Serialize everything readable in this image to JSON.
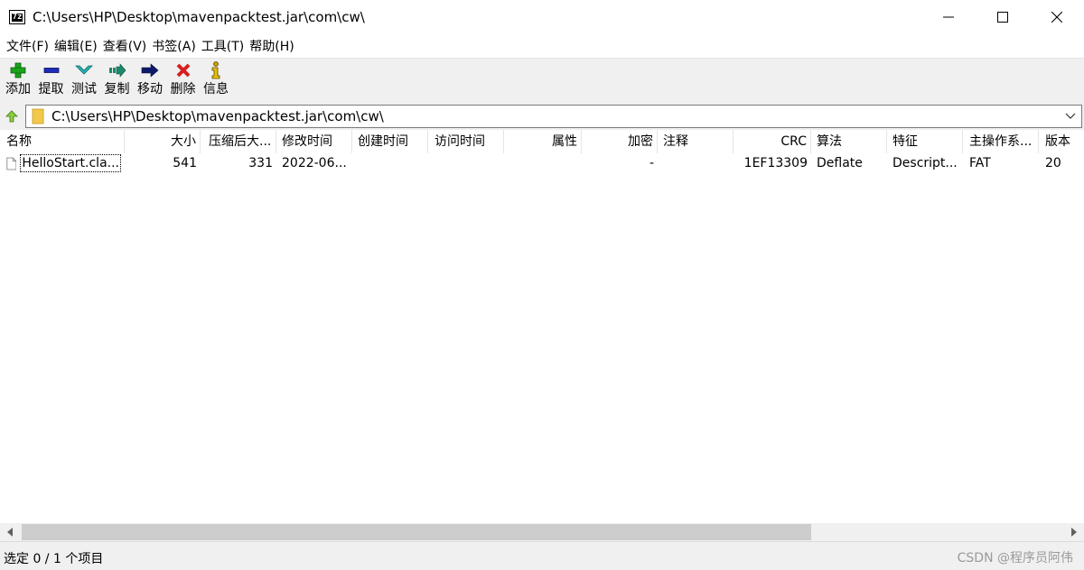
{
  "window": {
    "title": "C:\\Users\\HP\\Desktop\\mavenpacktest.jar\\com\\cw\\",
    "app_icon_text": "7z",
    "controls": [
      "minimize-icon",
      "maximize-icon",
      "close-icon"
    ]
  },
  "menu": {
    "items": [
      {
        "label": "文件(F)"
      },
      {
        "label": "编辑(E)"
      },
      {
        "label": "查看(V)"
      },
      {
        "label": "书签(A)"
      },
      {
        "label": "工具(T)"
      },
      {
        "label": "帮助(H)"
      }
    ]
  },
  "toolbar": {
    "buttons": [
      {
        "label": "添加",
        "icon": "plus-icon",
        "color": "#1aa31a"
      },
      {
        "label": "提取",
        "icon": "minus-icon",
        "color": "#1c2bb8"
      },
      {
        "label": "测试",
        "icon": "check-chevron-icon",
        "color": "#29b3b3"
      },
      {
        "label": "复制",
        "icon": "copy-arrow-icon",
        "color": "#1a8a6a"
      },
      {
        "label": "移动",
        "icon": "move-arrow-icon",
        "color": "#0d1a6b"
      },
      {
        "label": "删除",
        "icon": "delete-x-icon",
        "color": "#d81e1e"
      },
      {
        "label": "信息",
        "icon": "info-icon",
        "color": "#c8a000"
      }
    ]
  },
  "address": {
    "path": "C:\\Users\\HP\\Desktop\\mavenpacktest.jar\\com\\cw\\"
  },
  "table": {
    "columns": [
      "名称",
      "大小",
      "压缩后大...",
      "修改时间",
      "创建时间",
      "访问时间",
      "属性",
      "加密",
      "注释",
      "CRC",
      "算法",
      "特征",
      "主操作系...",
      "版本"
    ],
    "rows": [
      {
        "name": "HelloStart.cla...",
        "size": "541",
        "packed": "331",
        "modified": "2022-06...",
        "created": "",
        "accessed": "",
        "attributes": "",
        "encrypted": "-",
        "comment": "",
        "crc": "1EF13309",
        "method": "Deflate",
        "characteristics": "Descript...",
        "host_os": "FAT",
        "version": "20"
      }
    ]
  },
  "status": {
    "text": "选定 0 / 1 个项目"
  },
  "watermark": "CSDN @程序员阿伟"
}
